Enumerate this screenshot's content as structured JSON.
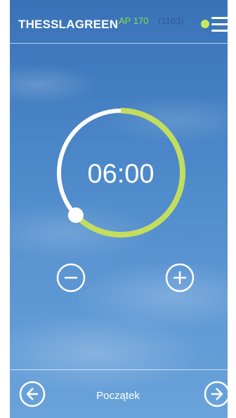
{
  "header": {
    "brand": "THESSLAGREEN",
    "model": "AP 170",
    "serial": "(1163)",
    "status_color": "#c9ea5a",
    "menu_icon": "hamburger-menu-icon"
  },
  "timer": {
    "time": "06:00",
    "progress_fraction": 0.63,
    "progress_color": "#c3dd5e",
    "track_color": "#ffffff"
  },
  "controls": {
    "decrease_icon": "minus-circle-icon",
    "increase_icon": "plus-circle-icon"
  },
  "footer": {
    "label": "Początek",
    "prev_icon": "arrow-left-circle-icon",
    "next_icon": "arrow-right-circle-icon"
  }
}
